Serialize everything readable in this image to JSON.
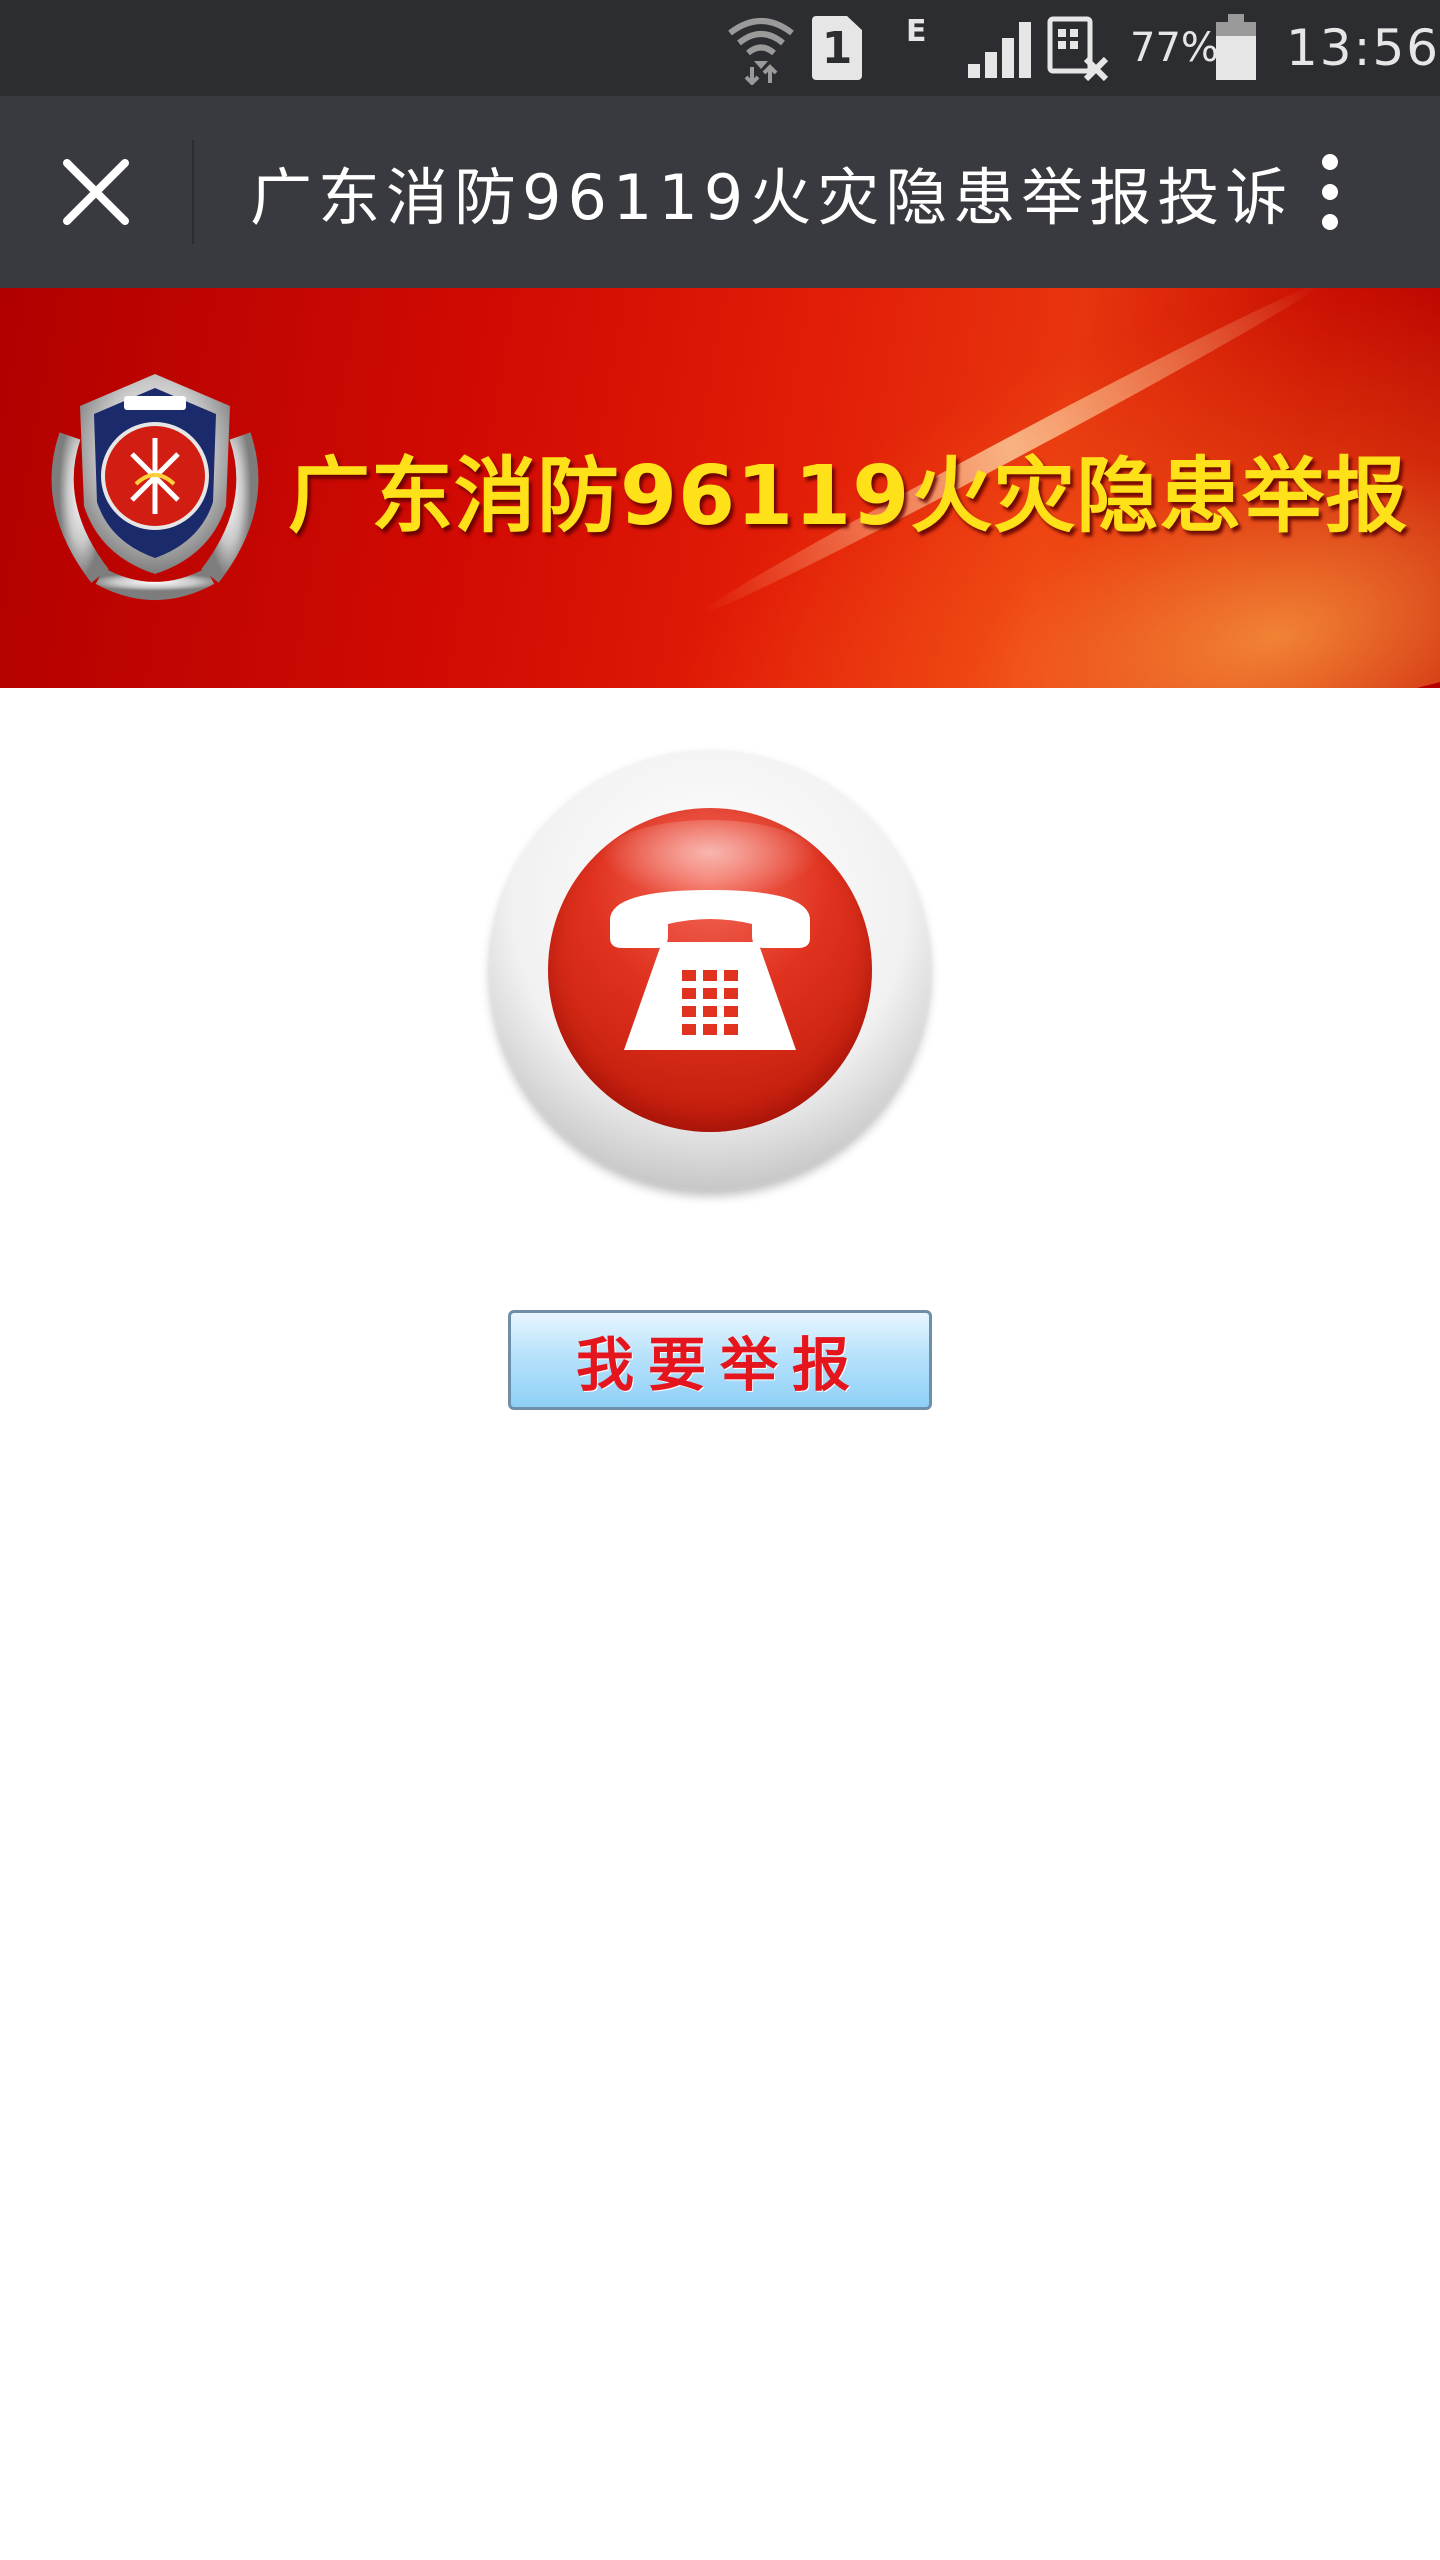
{
  "status_bar": {
    "sim_label": "1",
    "network_type": "E",
    "battery_percent": "77%",
    "time": "13:56",
    "icons": [
      "wifi-icon",
      "sim-icon",
      "signal-icon",
      "data-off-icon",
      "battery-icon"
    ]
  },
  "title_bar": {
    "title": "广东消防96119火灾隐患举报投诉",
    "icons": [
      "close-icon",
      "more-vert-icon"
    ]
  },
  "banner": {
    "heading": "广东消防96119火灾隐患举报",
    "emblem_icon": "fire-services-emblem"
  },
  "main": {
    "phone_icon": "telephone-icon",
    "report_button_label": "我要举报"
  },
  "colors": {
    "status_bar_bg": "#2c2d31",
    "title_bar_bg": "#393a3f",
    "banner_red": "#d30b03",
    "banner_text": "#ffe11a",
    "report_text": "#e4151c",
    "report_button_blue": "#8fd0f7"
  }
}
